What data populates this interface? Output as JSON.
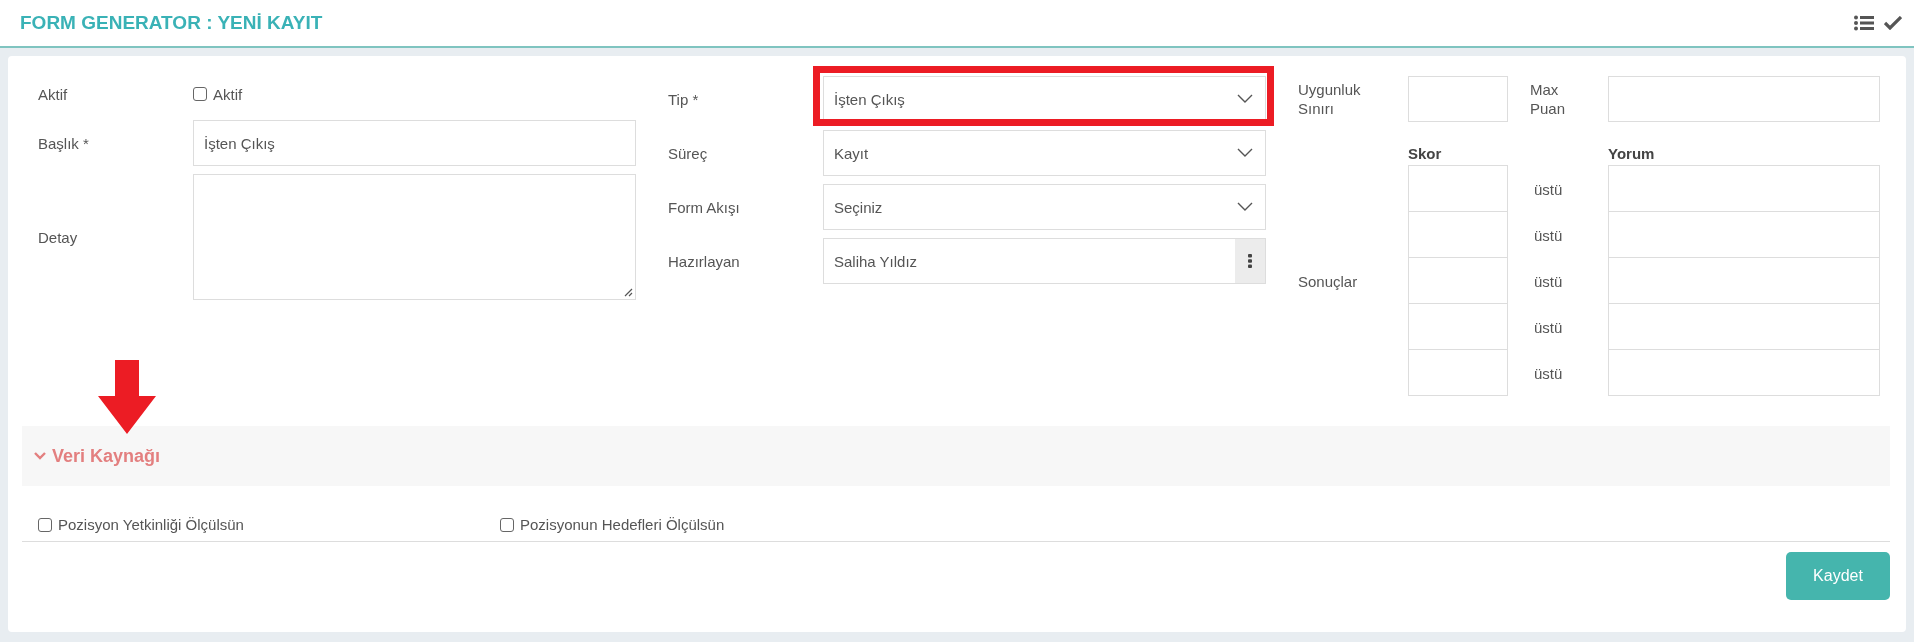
{
  "header": {
    "title": "FORM GENERATOR : YENİ KAYIT"
  },
  "form": {
    "aktif": {
      "label": "Aktif",
      "checkbox_label": "Aktif",
      "checked": false
    },
    "baslik": {
      "label": "Başlık *",
      "value": "İşten Çıkış"
    },
    "detay": {
      "label": "Detay"
    },
    "tip": {
      "label": "Tip *",
      "value": "İşten Çıkış",
      "highlighted": true
    },
    "surec": {
      "label": "Süreç",
      "value": "Kayıt"
    },
    "form_akisi": {
      "label": "Form Akışı",
      "value": "Seçiniz"
    },
    "hazirlayan": {
      "label": "Hazırlayan",
      "value": "Saliha Yıldız"
    },
    "uygunluk": {
      "label": "Uygunluk Sınırı"
    },
    "max_puan": {
      "label": "Max Puan"
    },
    "sonuclar": {
      "label": "Sonuçlar",
      "score_heading": "Skor",
      "comment_heading": "Yorum",
      "rows": [
        {
          "suffix": "üstü"
        },
        {
          "suffix": "üstü"
        },
        {
          "suffix": "üstü"
        },
        {
          "suffix": "üstü"
        },
        {
          "suffix": "üstü"
        }
      ]
    }
  },
  "section": {
    "title": "Veri Kaynağı",
    "expanded": true
  },
  "options": [
    {
      "label": "Pozisyon Yetkinliği Ölçülsün",
      "checked": false
    },
    {
      "label": "Pozisyonun Hedefleri Ölçülsün",
      "checked": false
    }
  ],
  "buttons": [
    {
      "label": "Kaydet"
    }
  ]
}
